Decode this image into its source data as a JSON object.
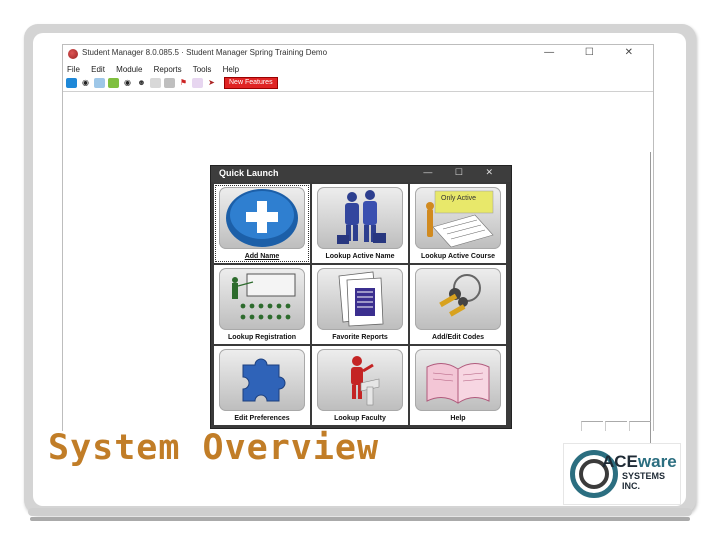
{
  "app": {
    "title": "Student Manager 8.0.085.5 · Student Manager Spring Training Demo",
    "window_controls": "— ☐ ✕",
    "menu": [
      "File",
      "Edit",
      "Module",
      "Reports",
      "Tools",
      "Help"
    ],
    "toolbar_icons": [
      "grid-icon",
      "binoculars-icon",
      "layout-icon",
      "grid-green-icon",
      "binoculars-icon",
      "user-icon",
      "print-icon",
      "keyboard-icon",
      "flag-icon",
      "chart-icon",
      "export-icon"
    ],
    "new_features_label": "New Features"
  },
  "quick_launch": {
    "title": "Quick Launch",
    "controls": "— ☐ ✕",
    "tiles": [
      {
        "label": "Add Name",
        "icon": "add-plus-icon"
      },
      {
        "label": "Lookup Active Name",
        "icon": "people-icon"
      },
      {
        "label": "Lookup Active Course",
        "icon": "active-course-icon",
        "badge": "Only Active"
      },
      {
        "label": "Lookup Registration",
        "icon": "classroom-icon"
      },
      {
        "label": "Favorite Reports",
        "icon": "reports-icon"
      },
      {
        "label": "Add/Edit Codes",
        "icon": "keys-icon"
      },
      {
        "label": "Edit Preferences",
        "icon": "puzzle-icon"
      },
      {
        "label": "Lookup Faculty",
        "icon": "faculty-icon"
      },
      {
        "label": "Help",
        "icon": "book-icon"
      }
    ]
  },
  "slide": {
    "heading": "System Overview",
    "logo": {
      "ace": "ACE",
      "ware": "ware",
      "line1": "SYSTEMS",
      "line2": "INC."
    }
  },
  "colors": {
    "heading": "#c17d27",
    "new_features": "#e02424",
    "quick_launch_bar": "#3d3d3d",
    "logo_teal": "#2b6e80"
  }
}
